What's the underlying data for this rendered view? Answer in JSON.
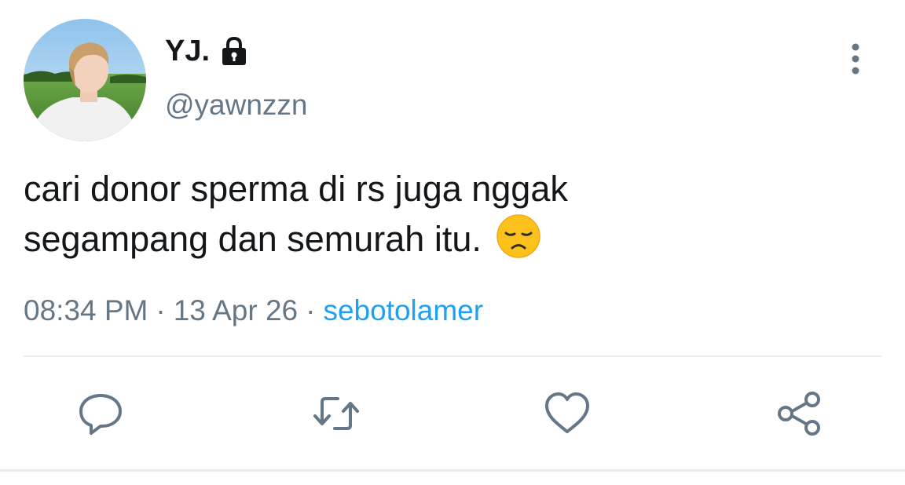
{
  "user": {
    "display_name": "YJ.",
    "handle": "@yawnzzn",
    "protected_icon": "lock-icon",
    "avatar": "avatar-photo"
  },
  "tweet": {
    "text_line1": "cari donor sperma di rs juga nggak",
    "text_line2": "segampang dan semurah itu.",
    "emoji": "disappointed-face-emoji"
  },
  "meta": {
    "time": "08:34 PM",
    "separator": "·",
    "date": "13 Apr 26",
    "source": "sebotolamer"
  },
  "actions": {
    "reply_icon": "reply-icon",
    "retweet_icon": "retweet-icon",
    "like_icon": "heart-icon",
    "share_icon": "share-icon",
    "more_icon": "more-vertical-icon"
  },
  "colors": {
    "text": "#14171a",
    "secondary": "#657786",
    "link": "#1da1f2",
    "divider": "#e6ecf0"
  }
}
